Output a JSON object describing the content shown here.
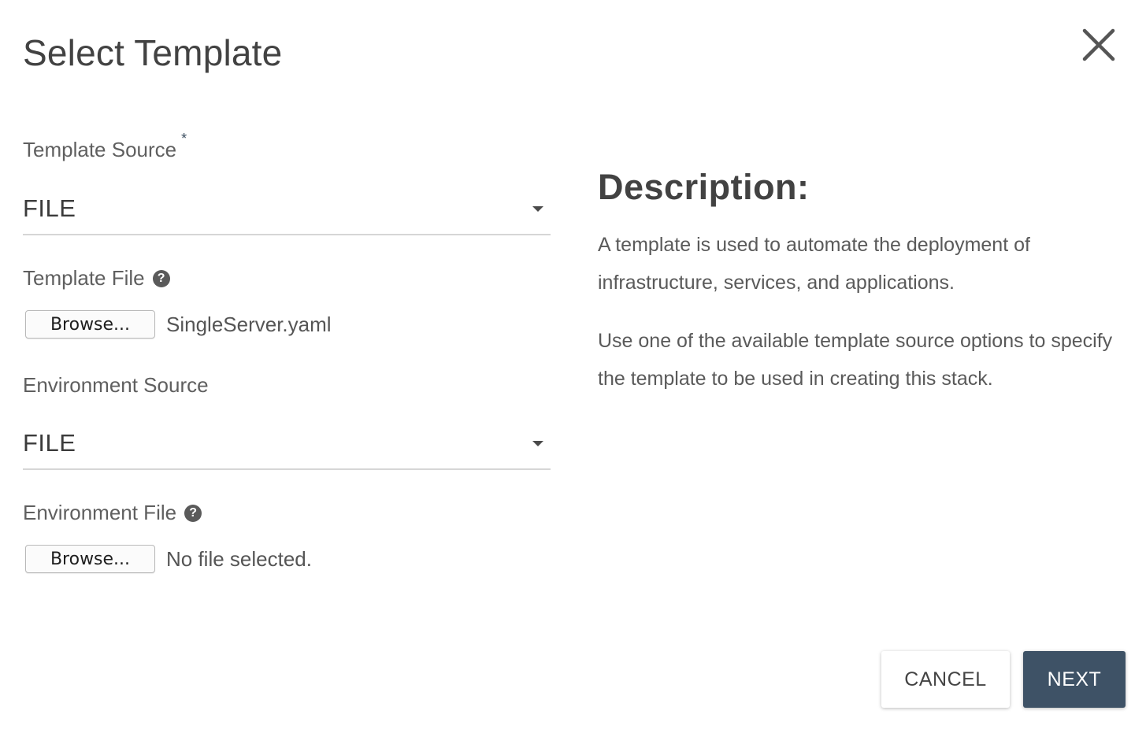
{
  "dialog": {
    "title": "Select Template",
    "close_icon": "close-icon"
  },
  "form": {
    "template_source": {
      "label": "Template Source",
      "required_mark": "*",
      "value": "FILE"
    },
    "template_file": {
      "label": "Template File",
      "help_icon": "help-icon",
      "browse_label": "Browse...",
      "file_name": "SingleServer.yaml"
    },
    "environment_source": {
      "label": "Environment Source",
      "value": "FILE"
    },
    "environment_file": {
      "label": "Environment File",
      "help_icon": "help-icon",
      "browse_label": "Browse...",
      "file_name": "No file selected."
    }
  },
  "description": {
    "title": "Description:",
    "paragraphs": [
      "A template is used to automate the deployment of infrastructure, services, and applications.",
      "Use one of the available template source options to specify the template to be used in creating this stack."
    ]
  },
  "footer": {
    "cancel_label": "CANCEL",
    "next_label": "NEXT"
  },
  "colors": {
    "primary_button": "#3e5266",
    "required_star": "#3d4f61",
    "underline": "#d6d6d6"
  }
}
